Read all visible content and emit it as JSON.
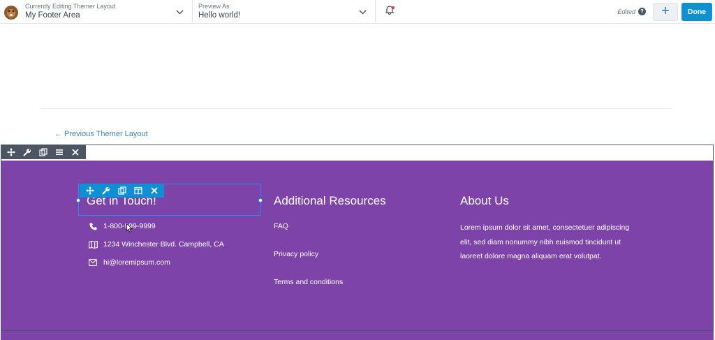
{
  "topbar": {
    "editing_label": "Currently Editing Themer Layout",
    "editing_value": "My Footer Area",
    "preview_label": "Preview As:",
    "preview_value": "Hello world!",
    "status": "Edited",
    "help_glyph": "?",
    "add_glyph": "+",
    "done_label": "Done"
  },
  "page": {
    "prev_link": "← Previous Themer Layout"
  },
  "footer": {
    "columns": [
      {
        "heading": "Get in Touch!"
      },
      {
        "heading": "Additional Resources"
      },
      {
        "heading": "About Us"
      }
    ],
    "contact": {
      "phone": "1-800-999-9999",
      "address": "1234 Winchester Blvd. Campbell, CA",
      "email": "hi@loremipsum.com"
    },
    "links": [
      "FAQ",
      "Privacy policy",
      "Terms and conditions"
    ],
    "about_text": "Lorem ipsum dolor sit amet, consectetuer adipiscing elit, sed diam nonummy nibh euismod tincidunt ut laoreet dolore magna aliquam erat volutpat."
  },
  "colors": {
    "footer_bg": "#7d43a8",
    "accent": "#0e90d2",
    "row_toolbar": "#4b5563"
  },
  "icons": {
    "row_toolbar": [
      "move-icon",
      "wrench-icon",
      "duplicate-icon",
      "menu-icon",
      "close-icon"
    ],
    "module_toolbar": [
      "move-icon",
      "wrench-icon",
      "duplicate-icon",
      "columns-icon",
      "close-icon"
    ]
  }
}
